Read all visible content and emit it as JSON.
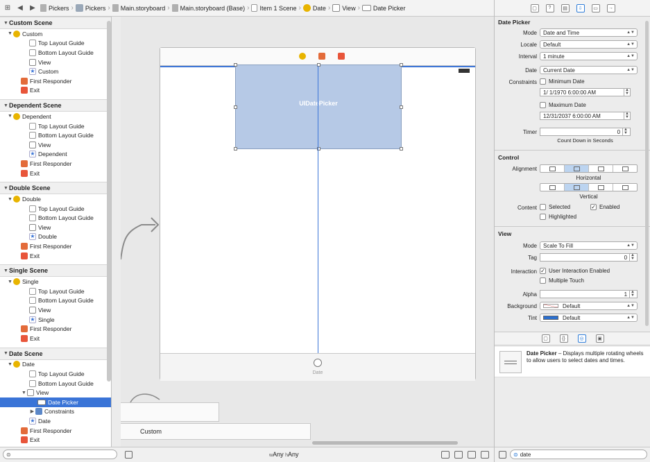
{
  "jumpbar": {
    "crumbs": [
      "Pickers",
      "Pickers",
      "Main.storyboard",
      "Main.storyboard (Base)",
      "Item 1 Scene",
      "Date",
      "View",
      "Date Picker"
    ]
  },
  "outline": {
    "sections": [
      {
        "title": "Custom Scene",
        "controller": "Custom",
        "items": [
          "Top Layout Guide",
          "Bottom Layout Guide",
          "View",
          "Custom"
        ],
        "responder": "First Responder",
        "exit": "Exit"
      },
      {
        "title": "Dependent Scene",
        "controller": "Dependent",
        "items": [
          "Top Layout Guide",
          "Bottom Layout Guide",
          "View",
          "Dependent"
        ],
        "responder": "First Responder",
        "exit": "Exit"
      },
      {
        "title": "Double Scene",
        "controller": "Double",
        "items": [
          "Top Layout Guide",
          "Bottom Layout Guide",
          "View",
          "Double"
        ],
        "responder": "First Responder",
        "exit": "Exit"
      },
      {
        "title": "Single Scene",
        "controller": "Single",
        "items": [
          "Top Layout Guide",
          "Bottom Layout Guide",
          "View",
          "Single"
        ],
        "responder": "First Responder",
        "exit": "Exit"
      },
      {
        "title": "Date Scene",
        "controller": "Date",
        "items": [
          "Top Layout Guide",
          "Bottom Layout Guide",
          "View"
        ],
        "selected": "Date Picker",
        "constraints": "Constraints",
        "last": "Date",
        "responder": "First Responder",
        "exit": "Exit"
      }
    ]
  },
  "canvas": {
    "picker_label": "UIDatePicker",
    "bottom_label": "Date",
    "custom_label": "Custom",
    "size_w": "Any",
    "size_h": "Any",
    "size_w_prefix": "w",
    "size_h_prefix": "h"
  },
  "inspector": {
    "section1": "Date Picker",
    "mode_label": "Mode",
    "mode_value": "Date and Time",
    "locale_label": "Locale",
    "locale_value": "Default",
    "interval_label": "Interval",
    "interval_value": "1 minute",
    "date_label": "Date",
    "date_value": "Current Date",
    "constraints_label": "Constraints",
    "min_date_label": "Minimum Date",
    "min_date_value": "1/  1/1970   6:00:00 AM",
    "max_date_label": "Maximum Date",
    "max_date_value": "12/31/2037   6:00:00 AM",
    "timer_label": "Timer",
    "timer_value": "0",
    "timer_caption": "Count Down in Seconds",
    "section2": "Control",
    "alignment_label": "Alignment",
    "horizontal_caption": "Horizontal",
    "vertical_caption": "Vertical",
    "content_label": "Content",
    "selected_label": "Selected",
    "enabled_label": "Enabled",
    "highlighted_label": "Highlighted",
    "section3": "View",
    "vmode_label": "Mode",
    "vmode_value": "Scale To Fill",
    "tag_label": "Tag",
    "tag_value": "0",
    "interaction_label": "Interaction",
    "uie_label": "User Interaction Enabled",
    "multitouch_label": "Multiple Touch",
    "alpha_label": "Alpha",
    "alpha_value": "1",
    "background_label": "Background",
    "background_value": "Default",
    "tint_label": "Tint",
    "tint_value": "Default"
  },
  "library": {
    "item_title": "Date Picker",
    "item_desc": " – Displays multiple rotating wheels to allow users to select dates and times.",
    "search_value": "date"
  },
  "colors": {
    "accent": "#3a74d7",
    "picker_fill": "#b6c9e6",
    "tint_swatch": "#2a6fd0"
  }
}
